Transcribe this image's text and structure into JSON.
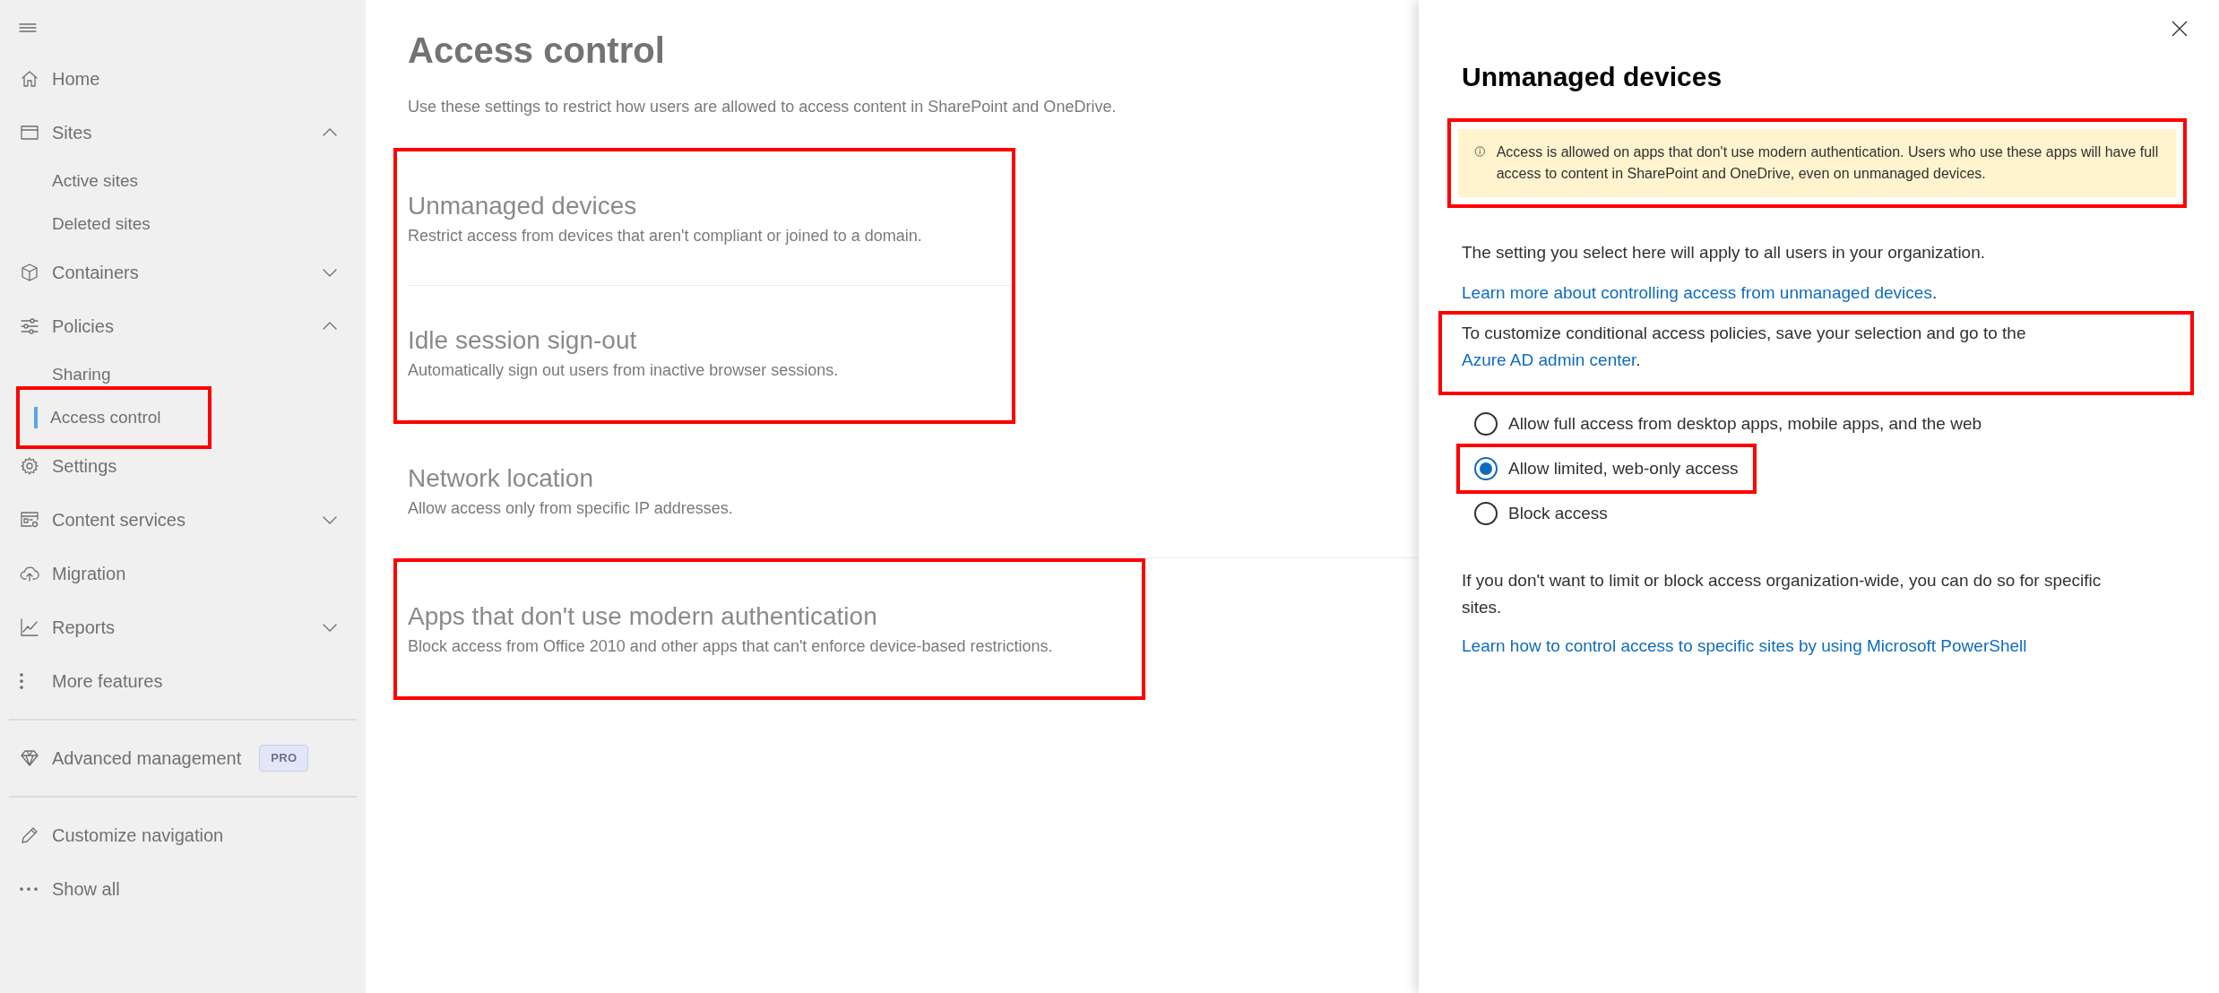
{
  "sidebar": {
    "groups": [
      {
        "items": [
          {
            "label": "Home",
            "selected": false
          },
          {
            "label": "Sites",
            "selected": false,
            "expanded": true,
            "children": [
              {
                "label": "Active sites",
                "selected": false,
                "highlighted": false
              },
              {
                "label": "Deleted sites",
                "selected": false,
                "highlighted": false
              }
            ]
          },
          {
            "label": "Containers",
            "selected": false,
            "expanded": false
          },
          {
            "label": "Policies",
            "selected": false,
            "expanded": true,
            "children": [
              {
                "label": "Sharing",
                "selected": false,
                "highlighted": false
              },
              {
                "label": "Access control",
                "selected": true,
                "highlighted": true
              }
            ]
          },
          {
            "label": "Settings",
            "selected": false
          },
          {
            "label": "Content services",
            "selected": false,
            "expanded": false
          },
          {
            "label": "Migration",
            "selected": false
          },
          {
            "label": "Reports",
            "selected": false,
            "expanded": false
          },
          {
            "label": "More features",
            "selected": false
          }
        ]
      },
      {
        "items": [
          {
            "label": "Advanced management",
            "selected": false,
            "badge": "PRO"
          }
        ]
      },
      {
        "items": [
          {
            "label": "Customize navigation",
            "selected": false
          },
          {
            "label": "Show all",
            "selected": false
          }
        ]
      }
    ]
  },
  "main": {
    "title": "Access control",
    "description": "Use these settings to restrict how users are allowed to access content in SharePoint and OneDrive.",
    "settings": [
      {
        "title": "Unmanaged devices",
        "description": "Restrict access from devices that aren't compliant or joined to a domain.",
        "highlighted": true
      },
      {
        "title": "Idle session sign-out",
        "description": "Automatically sign out users from inactive browser sessions.",
        "highlighted": true
      },
      {
        "title": "Network location",
        "description": "Allow access only from specific IP addresses.",
        "highlighted": false
      },
      {
        "title": "Apps that don't use modern authentication",
        "description": "Block access from Office 2010 and other apps that can't enforce device-based restrictions.",
        "highlighted": true
      }
    ]
  },
  "panel": {
    "title": "Unmanaged devices",
    "notice": {
      "text": "Access is allowed on apps that don't use modern authentication. Users who use these apps will have full access to content in SharePoint and OneDrive, even on unmanaged devices.",
      "highlighted": true
    },
    "intro": "The setting you select here will apply to all users in your organization.",
    "learn_more": {
      "link": "Learn more about controlling access from unmanaged devices",
      "after": "."
    },
    "conditional": {
      "before": "To customize conditional access policies, save your selection and go to the",
      "link": "Azure AD admin center",
      "after": ".",
      "highlighted": true
    },
    "options": [
      {
        "label": "Allow full access from desktop apps, mobile apps, and the web",
        "selected": false,
        "highlighted": false
      },
      {
        "label": "Allow limited, web-only access",
        "selected": true,
        "highlighted": true
      },
      {
        "label": "Block access",
        "selected": false,
        "highlighted": false
      }
    ],
    "site_note": "If you don't want to limit or block access organization-wide, you can do so for specific sites.",
    "powershell_link": "Learn how to control access to specific sites by using Microsoft PowerShell"
  }
}
